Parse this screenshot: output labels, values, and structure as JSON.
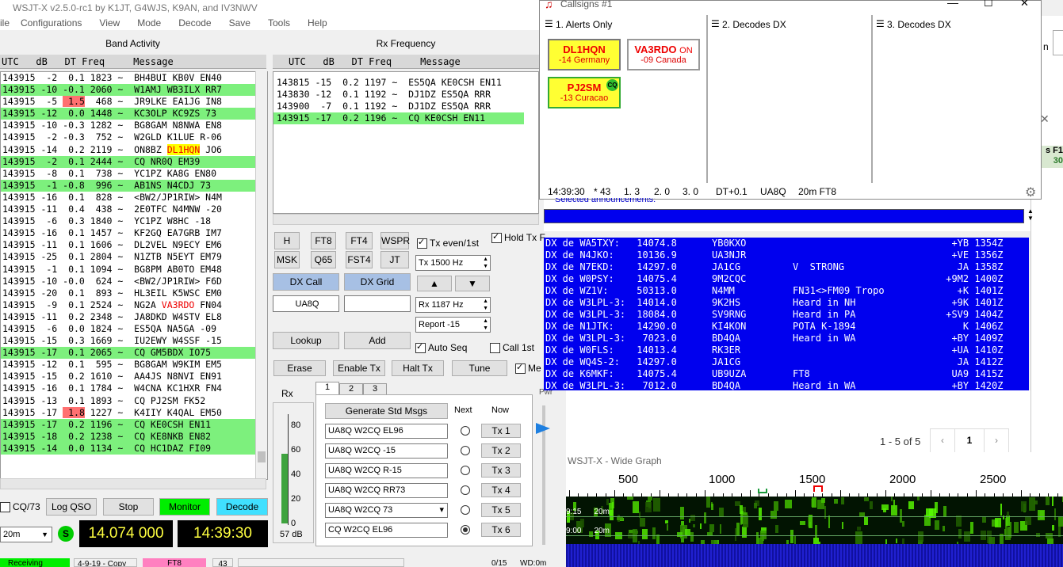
{
  "main": {
    "title": "WSJT-X   v2.5.0-rc1   by K1JT, G4WJS, K9AN, and IV3NWV",
    "menu": [
      "ile",
      "Configurations",
      "View",
      "Mode",
      "Decode",
      "Save",
      "Tools",
      "Help"
    ],
    "band_activity_title": "Band Activity",
    "rx_frequency_title": "Rx Frequency",
    "col_header": "UTC   dB   DT Freq     Message",
    "band_rows": [
      {
        "t": "143915  -2  0.1 1823 ~  BH4BUI KB0V EN40",
        "g": false
      },
      {
        "t": "143915 -10 -0.1 2060 ~  W1AMJ WB3ILX RR7",
        "g": true
      },
      {
        "t": "143915  -5  1.5  468 ~  JR9LKE EA1JG IN8",
        "g": false,
        "dtred": true
      },
      {
        "t": "143915 -12  0.0 1448 ~  KC3OLP KC9ZS 73",
        "g": true
      },
      {
        "t": "143915 -10 -0.3 1282 ~  BG8GAM N8NWA EN8",
        "g": false
      },
      {
        "t": "143915  -2 -0.3  752 ~  W2GLD K1LUE R-06",
        "g": false
      },
      {
        "t": "143915 -14  0.2 2119 ~  ON8BZ DL1HQN JO6",
        "g": false,
        "hl": "DL1HQN"
      },
      {
        "t": "143915  -2  0.1 2444 ~  CQ NR0Q EM39",
        "g": true
      },
      {
        "t": "143915  -8  0.1  738 ~  YC1PZ KA8G EN80",
        "g": false
      },
      {
        "t": "143915  -1 -0.8  996 ~  AB1NS N4CDJ 73",
        "g": true
      },
      {
        "t": "143915 -16  0.1  828 ~  <BW2/JP1RIW> N4M",
        "g": false
      },
      {
        "t": "143915 -11  0.4  438 ~  2E0TFC N4MNW -20",
        "g": false
      },
      {
        "t": "143915  -6  0.3 1840 ~  YC1PZ W8HC -18",
        "g": false
      },
      {
        "t": "143915 -16  0.1 1457 ~  KF2GQ EA7GRB IM7",
        "g": false
      },
      {
        "t": "143915 -11  0.1 1606 ~  DL2VEL N9ECY EM6",
        "g": false
      },
      {
        "t": "143915 -25  0.1 2804 ~  N1ZTB N5EYT EM79",
        "g": false
      },
      {
        "t": "143915  -1  0.1 1094 ~  BG8PM AB0TO EM48",
        "g": false
      },
      {
        "t": "143915 -10 -0.0  624 ~  <BW2/JP1RIW> F6D",
        "g": false
      },
      {
        "t": "143915 -20  0.1  893 ~  HL3EIL K5WSC EM0",
        "g": false
      },
      {
        "t": "143915  -9  0.1 2524 ~  NG2A VA3RDO FN04",
        "g": false,
        "red": "VA3RDO"
      },
      {
        "t": "143915 -11  0.2 2348 ~  JA8DKD W4STV EL8",
        "g": false
      },
      {
        "t": "143915  -6  0.0 1824 ~  ES5QA NA5GA -09",
        "g": false
      },
      {
        "t": "143915 -15  0.3 1669 ~  IU2EWY W4SSF -15",
        "g": false
      },
      {
        "t": "143915 -17  0.1 2065 ~  CQ GM5BDX IO75",
        "g": true
      },
      {
        "t": "143915 -12  0.1  595 ~  BG8GAM W9KIM EM5",
        "g": false
      },
      {
        "t": "143915 -15  0.2 1610 ~  AA4JS N8NVI EN91",
        "g": false
      },
      {
        "t": "143915 -16  0.1 1784 ~  W4CNA KC1HXR FN4",
        "g": false
      },
      {
        "t": "143915 -13  0.1 1893 ~  CQ PJ2SM FK52",
        "g": false,
        "cqhl": "CQ PJ2SM"
      },
      {
        "t": "143915 -17  1.8 1227 ~  K4IIY K4QAL EM50",
        "g": false,
        "dtred": true
      },
      {
        "t": "143915 -17  0.2 1196 ~  CQ KE0CSH EN11",
        "g": true
      },
      {
        "t": "143915 -18  0.2 1238 ~  CQ KE8NKB EN82",
        "g": true
      },
      {
        "t": "143915 -14  0.0 1134 ~  CQ HC1DAZ FI09",
        "g": true
      }
    ],
    "rx_rows": [
      {
        "t": "143815 -15  0.2 1197 ~  ES5QA KE0CSH EN11",
        "g": false
      },
      {
        "t": "143830 -12  0.1 1192 ~  DJ1DZ ES5QA RRR",
        "g": false
      },
      {
        "t": "143900  -7  0.1 1192 ~  DJ1DZ ES5QA RRR",
        "g": false
      },
      {
        "t": "143915 -17  0.2 1196 ~  CQ KE0CSH EN11",
        "g": true
      }
    ],
    "mode_buttons": [
      "H",
      "FT8",
      "FT4",
      "WSPR",
      "MSK",
      "Q65",
      "FST4",
      "JT"
    ],
    "tx_even_label": "Tx even/1st",
    "hold_tx_label": "Hold Tx F",
    "tx_freq": "Tx  1500 Hz",
    "rx_freq": "Rx  1187 Hz",
    "report": "Report -15",
    "dx_call_label": "DX Call",
    "dx_grid_label": "DX Grid",
    "dx_call_value": "UA8Q",
    "dx_grid_value": "",
    "lookup_label": "Lookup",
    "add_label": "Add",
    "auto_seq_label": "Auto Seq",
    "call1st_label": "Call 1st",
    "erase_label": "Erase",
    "enable_tx_label": "Enable Tx",
    "halt_tx_label": "Halt Tx",
    "tune_label": "Tune",
    "me_label": "Me",
    "cq73_label": "CQ/73",
    "logqso_label": "Log QSO",
    "stop_label": "Stop",
    "monitor_label": "Monitor",
    "decode_label": "Decode",
    "band": "20m",
    "s_label": "S",
    "dial_freq": "14.074 000",
    "clock": "14:39:30",
    "rx_label": "Rx",
    "meter_ticks": [
      "80",
      "60",
      "40",
      "20",
      "0"
    ],
    "meter_db": "57 dB",
    "pwr_label": "Pwr",
    "tabs": [
      "1",
      "2",
      "3"
    ],
    "gen_std_label": "Generate Std Msgs",
    "next_label": "Next",
    "now_label": "Now",
    "tx_msgs": [
      "UA8Q W2CQ EL96",
      "UA8Q W2CQ -15",
      "UA8Q W2CQ R-15",
      "UA8Q W2CQ RR73",
      "UA8Q W2CQ 73",
      "CQ W2CQ EL96"
    ],
    "tx_buttons": [
      "Tx 1",
      "Tx 2",
      "Tx 3",
      "Tx 4",
      "Tx 5",
      "Tx 6"
    ],
    "status": [
      "Receiving",
      "4-9-19 - Copy",
      "FT8",
      "43",
      "0/15",
      "WD:0m"
    ]
  },
  "callsigns": {
    "title": "Callsigns #1",
    "panes": [
      "1. Alerts Only",
      "2. Decodes DX",
      "3. Decodes DX"
    ],
    "alerts": [
      {
        "call": "DL1HQN",
        "info": "-14  Germany"
      },
      {
        "call": "VA3RDO",
        "on": "ON",
        "info": "-09  Canada"
      },
      {
        "call": "PJ2SM",
        "cq": "CQ",
        "info": "-13  Curacao"
      }
    ],
    "status": [
      "14:39:30",
      "* 43",
      "1.  3",
      "2.  0",
      "3.  0",
      "DT+0.1",
      "UA8Q",
      "20m FT8"
    ]
  },
  "cluster": {
    "partial_line": "Selected announcements:",
    "rows": [
      {
        "dx": "DX de WA5TXY:",
        "f": "14074.8",
        "c": "YB0KXO",
        "cm": "",
        "s": "+YB 1354Z"
      },
      {
        "dx": "DX de N4JKO:",
        "f": "10136.9",
        "c": "UA3NJR",
        "cm": "",
        "s": "+VE 1356Z"
      },
      {
        "dx": "DX de N7EKD:",
        "f": "14297.0",
        "c": "JA1CG",
        "cm": "V  STRONG",
        "s": "JA 1358Z"
      },
      {
        "dx": "DX de W0PSY:",
        "f": "14075.4",
        "c": "9M2CQC",
        "cm": "",
        "s": "+9M2 1400Z"
      },
      {
        "dx": "DX de WZ1V:",
        "f": "50313.0",
        "c": "N4MM",
        "cm": "FN31<>FM09 Tropo",
        "s": "+K 1401Z"
      },
      {
        "dx": "DX de W3LPL-3:",
        "f": "14014.0",
        "c": "9K2HS",
        "cm": "Heard in NH",
        "s": "+9K 1401Z"
      },
      {
        "dx": "DX de W3LPL-3:",
        "f": "18084.0",
        "c": "SV9RNG",
        "cm": "Heard in PA",
        "s": "+SV9 1404Z"
      },
      {
        "dx": "DX de N1JTK:",
        "f": "14290.0",
        "c": "KI4KON",
        "cm": "POTA K-1894",
        "s": "K 1406Z"
      },
      {
        "dx": "DX de W3LPL-3:",
        "f": "7023.0",
        "c": "BD4QA",
        "cm": "Heard in WA",
        "s": "+BY 1409Z"
      },
      {
        "dx": "DX de W0FLS:",
        "f": "14013.4",
        "c": "RK3ER",
        "cm": "",
        "s": "+UA 1410Z"
      },
      {
        "dx": "DX de WQ4S-2:",
        "f": "14297.0",
        "c": "JA1CG",
        "cm": "",
        "s": "JA 1412Z"
      },
      {
        "dx": "DX de K6MKF:",
        "f": "14075.4",
        "c": "UB9UZA",
        "cm": "FT8",
        "s": "UA9 1415Z"
      },
      {
        "dx": "DX de W3LPL-3:",
        "f": "7012.0",
        "c": "BD4QA",
        "cm": "Heard in WA",
        "s": "+BY 1420Z"
      }
    ]
  },
  "pager": {
    "text": "1 - 5 of 5",
    "page": "1"
  },
  "widegraph": {
    "title": "WSJT-X - Wide Graph",
    "ticks": [
      "500",
      "1000",
      "1500",
      "2000",
      "2500"
    ],
    "lines": [
      {
        "t": "9:15",
        "b": "20m"
      },
      {
        "t": "9:00",
        "b": "20m"
      }
    ]
  },
  "side_fragments": {
    "f1": "s F1",
    "n30": "30",
    "m": "n"
  },
  "colors": {
    "green": "#7df07d",
    "yellow": "#ffff00",
    "alert_yellow": "#ffff33",
    "cluster_blue": "#0000ee",
    "monitor": "#00ee00",
    "decode": "#40e0ff",
    "dial_bg": "#000000",
    "dial_fg": "#ffff40"
  }
}
